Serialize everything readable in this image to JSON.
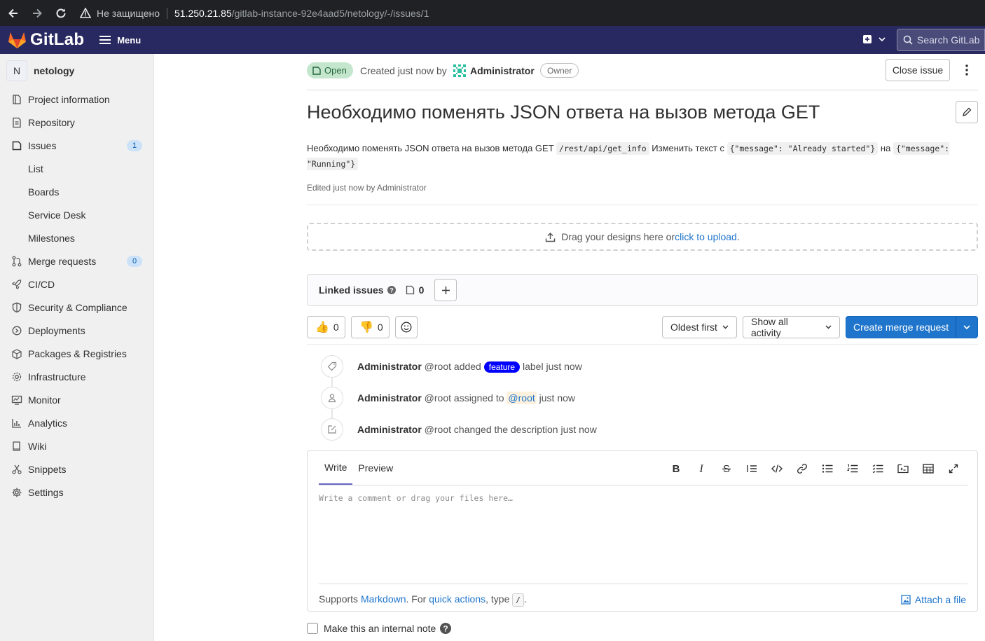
{
  "browser": {
    "security_label": "Не защищено",
    "url_host": "51.250.21.85",
    "url_path": "/gitlab-instance-92e4aad5/netology/-/issues/1"
  },
  "header": {
    "brand": "GitLab",
    "menu_label": "Menu",
    "search_placeholder": "Search GitLab",
    "brand_color": "#292961"
  },
  "sidebar": {
    "project_initial": "N",
    "project_name": "netology",
    "items": [
      {
        "label": "Project information",
        "icon": "project-icon"
      },
      {
        "label": "Repository",
        "icon": "doc-icon"
      },
      {
        "label": "Issues",
        "icon": "issues-icon",
        "badge": "1"
      },
      {
        "label": "List",
        "sub": true
      },
      {
        "label": "Boards",
        "sub": true
      },
      {
        "label": "Service Desk",
        "sub": true
      },
      {
        "label": "Milestones",
        "sub": true
      },
      {
        "label": "Merge requests",
        "icon": "merge-request-icon",
        "badge": "0"
      },
      {
        "label": "CI/CD",
        "icon": "rocket-icon"
      },
      {
        "label": "Security & Compliance",
        "icon": "shield-icon"
      },
      {
        "label": "Deployments",
        "icon": "deployments-icon"
      },
      {
        "label": "Packages & Registries",
        "icon": "package-icon"
      },
      {
        "label": "Infrastructure",
        "icon": "cloud-gear-icon"
      },
      {
        "label": "Monitor",
        "icon": "monitor-icon"
      },
      {
        "label": "Analytics",
        "icon": "chart-icon"
      },
      {
        "label": "Wiki",
        "icon": "book-icon"
      },
      {
        "label": "Snippets",
        "icon": "snippet-icon"
      },
      {
        "label": "Settings",
        "icon": "settings-icon"
      }
    ]
  },
  "issue": {
    "status": "Open",
    "created_text": "Created just now by",
    "author": "Administrator",
    "author_role": "Owner",
    "close_label": "Close issue",
    "title": "Необходимо поменять JSON ответа на вызов метода GET",
    "description": {
      "part1": "Необходимо поменять JSON ответа на вызов метода GET ",
      "code1": "/rest/api/get_info",
      "part2": " Изменить текст с ",
      "code2": "{\"message\": \"Already started\"}",
      "part3": " на ",
      "code3": "{\"message\": \"Running\"}"
    },
    "edited_note": "Edited just now by Administrator"
  },
  "designs": {
    "text": "Drag your designs here or ",
    "link": "click to upload",
    "suffix": "."
  },
  "linked_issues": {
    "title": "Linked issues",
    "count": "0"
  },
  "reactions": {
    "thumbs_up": "0",
    "thumbs_down": "0"
  },
  "controls": {
    "sort": "Oldest first",
    "activity_filter": "Show all activity",
    "create_mr": "Create merge request"
  },
  "timeline": [
    {
      "author": "Administrator",
      "pre": " @root added ",
      "label": "feature",
      "post": " label just now",
      "icon": "label-icon"
    },
    {
      "author": "Administrator",
      "pre": " @root assigned to ",
      "mention": "@root",
      "post": " just now",
      "icon": "user-icon"
    },
    {
      "author": "Administrator",
      "pre": " @root changed the description just now",
      "icon": "edit-icon"
    }
  ],
  "comment": {
    "tab_write": "Write",
    "tab_preview": "Preview",
    "placeholder": "Write a comment or drag your files here…",
    "help_prefix": "Supports ",
    "help_markdown": "Markdown",
    "help_mid": ". For ",
    "help_quick": "quick actions",
    "help_type": ", type ",
    "help_code": "/",
    "help_end": ".",
    "attach_label": "Attach a file",
    "internal_note_label": "Make this an internal note"
  },
  "colors": {
    "label_feature": "#0000ff",
    "primary": "#1f75cb",
    "open_badge_bg": "#c3e6cd"
  }
}
